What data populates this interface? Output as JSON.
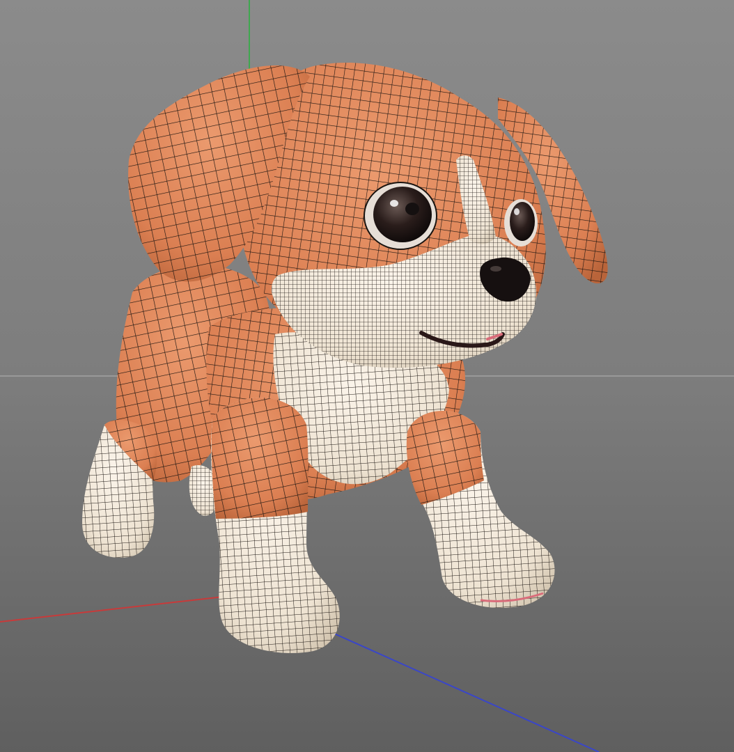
{
  "viewport": {
    "kind": "3d-viewport",
    "background": {
      "top": "#8a8a8a",
      "horizon": "#7c7c7c",
      "bottom": "#606060"
    }
  },
  "axes": {
    "x": {
      "color": "#c83a3a"
    },
    "y": {
      "color": "#3fa84f"
    },
    "z": {
      "color": "#3a46c8"
    },
    "horizon_line": {
      "color": "#9a9a9a"
    }
  },
  "model": {
    "name_icon": "puppy-mesh",
    "display": "wireframe-on-shaded",
    "colors": {
      "fur_orange": "#e0875a",
      "fur_orange_shade": "#c9703f",
      "fur_cream": "#f1e7d8",
      "fur_cream_shade": "#d9ccb8",
      "eye": "#1b1414",
      "eye_highlight": "#ffffff",
      "nose": "#151010",
      "mouth": "#2a1818",
      "tongue": "#d96c7a",
      "wire": "#1a1410"
    }
  }
}
